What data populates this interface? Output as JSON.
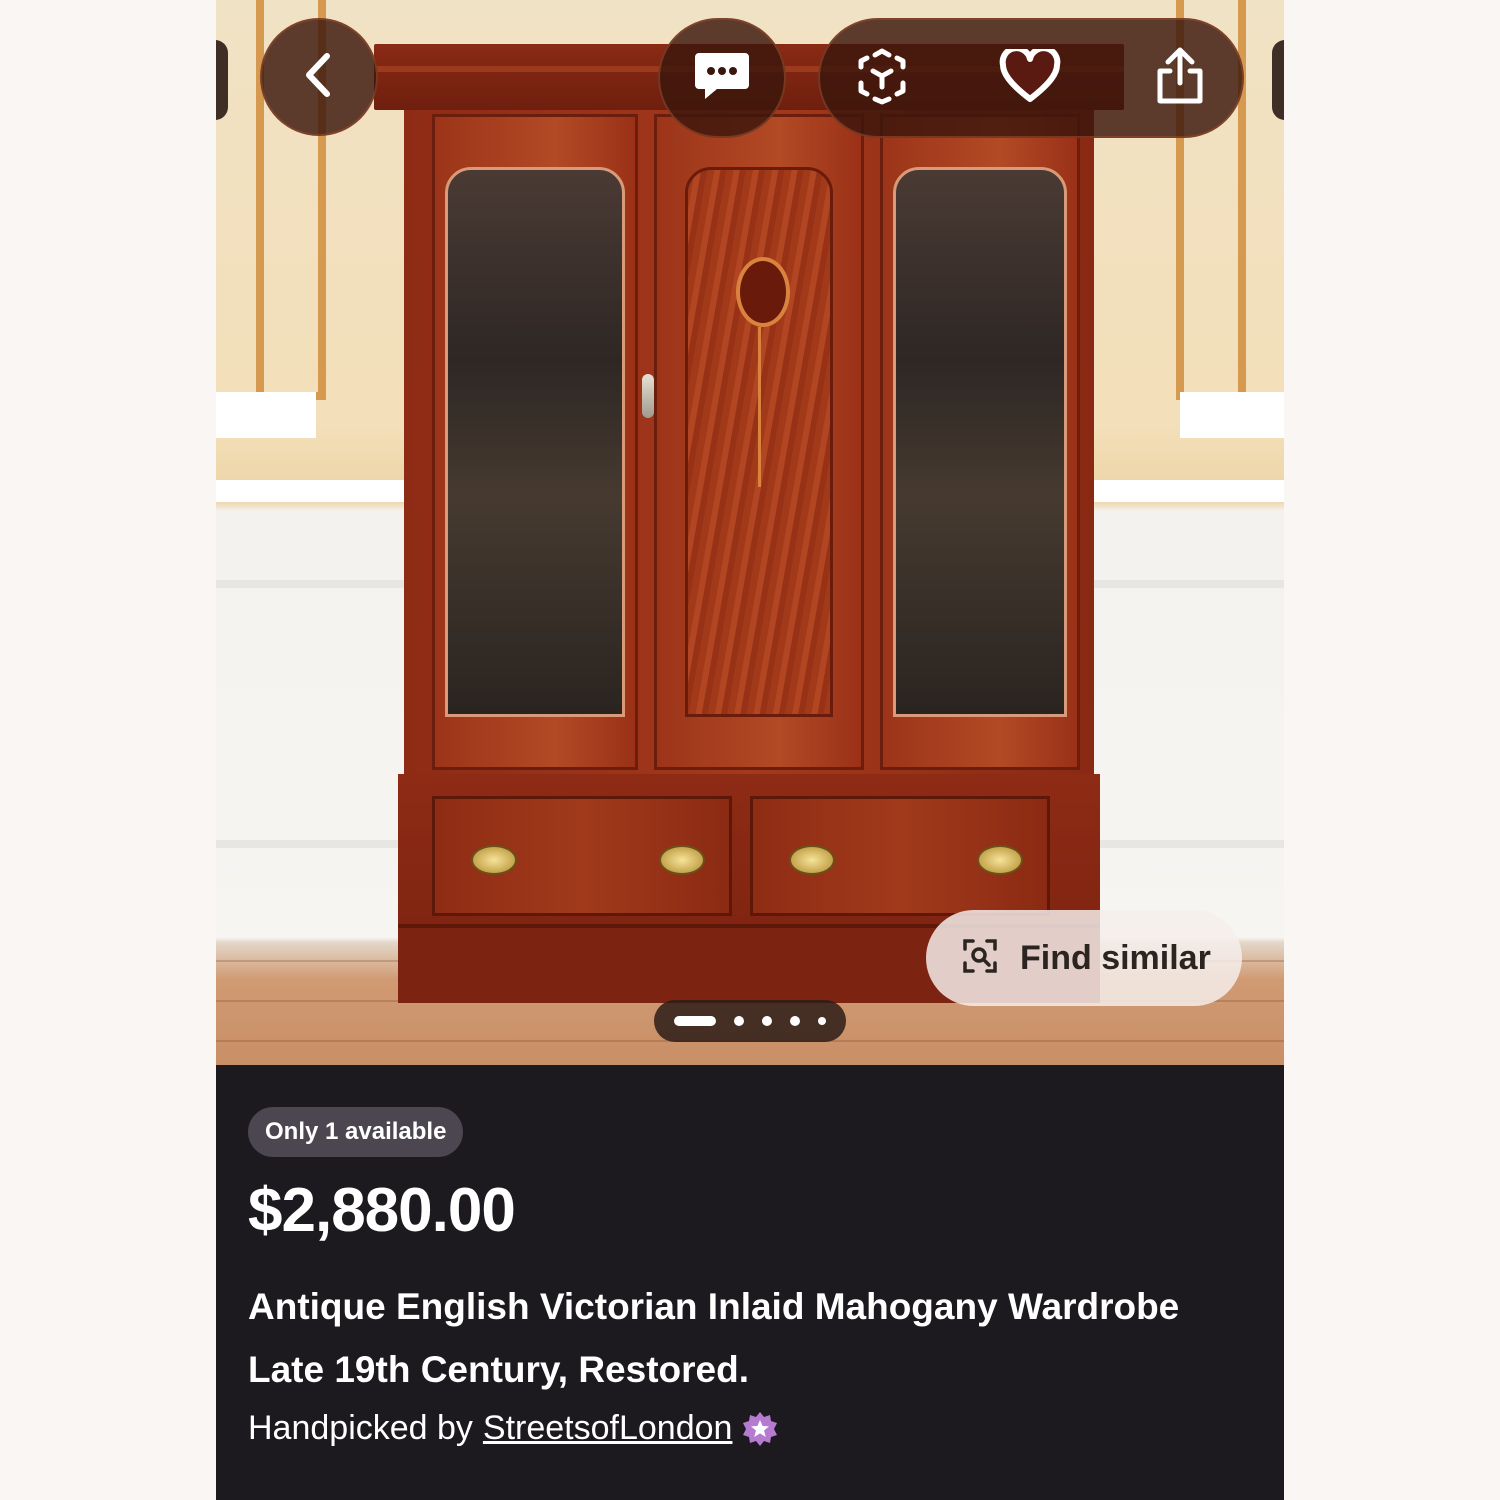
{
  "toolbar": {
    "back_icon": "chevron-left-icon",
    "message_icon": "chat-bubble-ellipsis-icon",
    "ar_icon": "ar-cube-icon",
    "favorite_icon": "heart-icon",
    "share_icon": "share-upload-icon"
  },
  "gallery": {
    "find_similar_label": "Find similar",
    "find_similar_icon": "visual-search-icon",
    "image_count": 5,
    "active_image_index": 0
  },
  "listing": {
    "availability_badge": "Only 1 available",
    "price": "$2,880.00",
    "title": "Antique English Victorian Inlaid Mahogany Wardrobe Late 19th Century, Restored.",
    "handpicked_prefix": "Handpicked by",
    "seller_name": "StreetsofLondon",
    "seller_badge_icon": "star-seal-icon"
  },
  "colors": {
    "overlay_button_bg": "#3a160c",
    "info_panel_bg": "#1c1a1e",
    "badge_bg": "#4c4651",
    "seller_badge": "#b57bd1"
  }
}
